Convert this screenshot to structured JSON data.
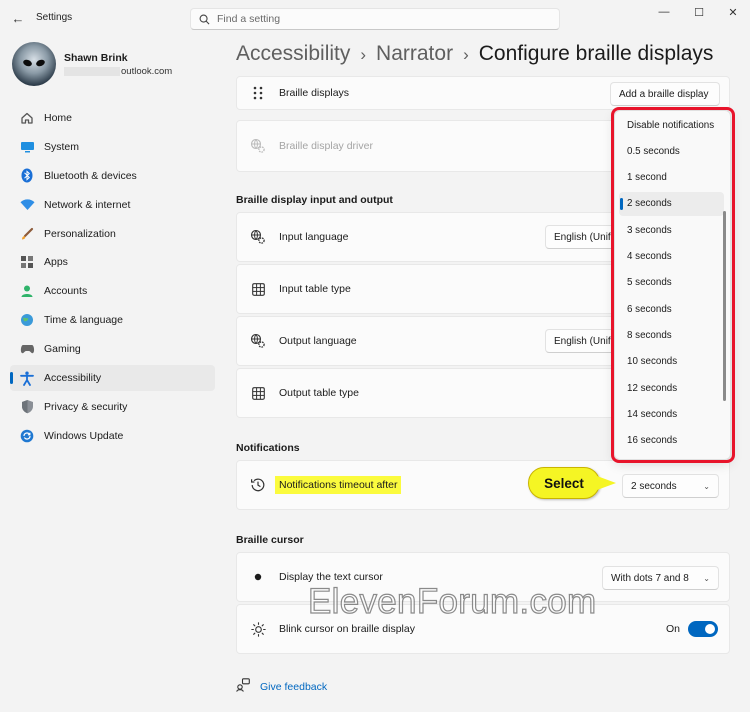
{
  "window": {
    "app_title": "Settings",
    "minimize": "—",
    "maximize": "☐",
    "close": "✕",
    "back": "←"
  },
  "search": {
    "placeholder": "Find a setting"
  },
  "profile": {
    "name": "Shawn Brink",
    "email_suffix": "outlook.com"
  },
  "sidebar": {
    "items": [
      {
        "label": "Home",
        "icon": "home-icon"
      },
      {
        "label": "System",
        "icon": "system-icon"
      },
      {
        "label": "Bluetooth & devices",
        "icon": "bluetooth-icon"
      },
      {
        "label": "Network & internet",
        "icon": "wifi-icon"
      },
      {
        "label": "Personalization",
        "icon": "brush-icon"
      },
      {
        "label": "Apps",
        "icon": "apps-icon"
      },
      {
        "label": "Accounts",
        "icon": "accounts-icon"
      },
      {
        "label": "Time & language",
        "icon": "globe-icon"
      },
      {
        "label": "Gaming",
        "icon": "gaming-icon"
      },
      {
        "label": "Accessibility",
        "icon": "accessibility-icon",
        "active": true
      },
      {
        "label": "Privacy & security",
        "icon": "shield-icon"
      },
      {
        "label": "Windows Update",
        "icon": "update-icon"
      }
    ]
  },
  "breadcrumb": {
    "part1": "Accessibility",
    "part2": "Narrator",
    "current": "Configure braille displays",
    "separator": "›"
  },
  "braille": {
    "displays_label": "Braille displays",
    "add_display_button": "Add a braille display",
    "driver_label": "Braille display driver"
  },
  "io_section": {
    "title": "Braille display input and output",
    "input_language_label": "Input language",
    "input_language_value": "English (Unifi",
    "input_table_label": "Input table type",
    "output_language_label": "Output language",
    "output_language_value": "English (Unifi",
    "output_table_label": "Output table type"
  },
  "notifications": {
    "title": "Notifications",
    "timeout_label": "Notifications timeout after",
    "timeout_value": "2 seconds",
    "callout": "Select"
  },
  "dropdown": {
    "options": [
      "Disable notifications",
      "0.5 seconds",
      "1 second",
      "2 seconds",
      "3 seconds",
      "4 seconds",
      "5 seconds",
      "6 seconds",
      "8 seconds",
      "10 seconds",
      "12 seconds",
      "14 seconds",
      "16 seconds"
    ],
    "selected": "2 seconds"
  },
  "cursor_section": {
    "title": "Braille cursor",
    "display_cursor_label": "Display the text cursor",
    "display_cursor_value": "With dots 7 and 8",
    "blink_label": "Blink cursor on braille display",
    "blink_state": "On"
  },
  "feedback": {
    "label": "Give feedback"
  },
  "watermark": "ElevenForum.com",
  "colors": {
    "accent": "#0067c0",
    "highlight": "#fbfb3e",
    "outline": "#e8142b",
    "callout": "#f5f524"
  }
}
